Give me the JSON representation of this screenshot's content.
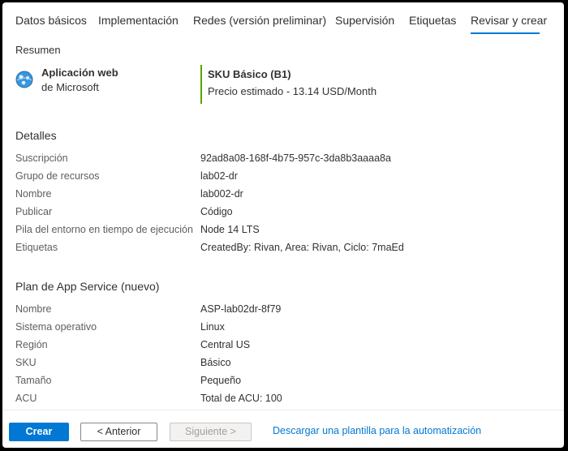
{
  "tabs": [
    {
      "label": "Datos básicos"
    },
    {
      "label": "Implementación"
    },
    {
      "label": "Redes (versión preliminar)"
    },
    {
      "label": "Supervisión"
    },
    {
      "label": "Etiquetas"
    },
    {
      "label": "Revisar y crear"
    }
  ],
  "active_tab": "Revisar y crear",
  "summary": {
    "label": "Resumen",
    "app_name": "Aplicación web",
    "app_vendor": "de Microsoft",
    "sku_title": "SKU Básico (B1)",
    "sku_price": "Precio estimado - 13.14 USD/Month"
  },
  "details": {
    "heading": "Detalles",
    "rows": [
      {
        "label": "Suscripción",
        "value": "92ad8a08-168f-4b75-957c-3da8b3aaaa8a"
      },
      {
        "label": "Grupo de recursos",
        "value": "lab02-dr"
      },
      {
        "label": "Nombre",
        "value": "lab002-dr"
      },
      {
        "label": "Publicar",
        "value": "Código"
      },
      {
        "label": "Pila del entorno en tiempo de ejecución",
        "value": "Node 14 LTS"
      },
      {
        "label": "Etiquetas",
        "value": "CreatedBy: Rivan, Area: Rivan, Ciclo: 7maEd"
      }
    ]
  },
  "plan": {
    "heading": "Plan de App Service (nuevo)",
    "rows": [
      {
        "label": "Nombre",
        "value": "ASP-lab02dr-8f79"
      },
      {
        "label": "Sistema operativo",
        "value": "Linux"
      },
      {
        "label": "Región",
        "value": "Central US"
      },
      {
        "label": "SKU",
        "value": "Básico"
      },
      {
        "label": "Tamaño",
        "value": "Pequeño"
      },
      {
        "label": "ACU",
        "value": "Total de ACU: 100"
      }
    ]
  },
  "footer": {
    "create_label": "Crear",
    "previous_label": "< Anterior",
    "next_label": "Siguiente >",
    "download_label": "Descargar una plantilla para la automatización"
  },
  "colors": {
    "accent": "#0078d4",
    "sku_bar": "#57a300"
  }
}
